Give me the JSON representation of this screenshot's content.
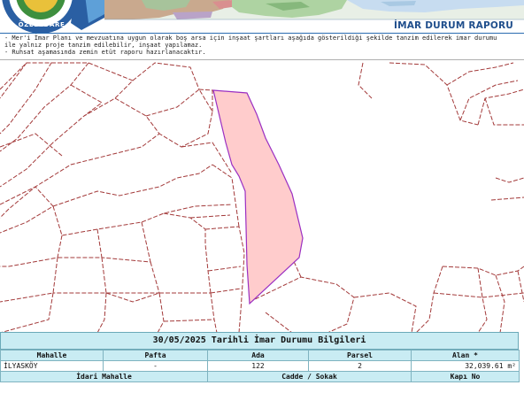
{
  "header": {
    "logo_text": "ÖZEL İDARE",
    "report_title": "İMAR DURUM RAPORU"
  },
  "notes": [
    "- Mer'i İmar Planı ve mevzuatına uygun olarak boş arsa için inşaat şartları aşağıda gösterildiği şekilde tanzim edilerek imar durumu",
    "ile yalnız proje tanzim edilebilir, inşaat yapılamaz.",
    "- Ruhsat aşamasında zemin etüt raporu hazırlanacaktır."
  ],
  "colors": {
    "parcel_highlight_fill": "#ffcccc",
    "parcel_highlight_stroke": "#9b2fc2",
    "parcel_lines": "#a33a3a",
    "table_header_bg": "#c9ecf3",
    "title_blue": "#1f4e8c"
  },
  "info": {
    "title": "30/05/2025 Tarihli İmar Durumu Bilgileri",
    "headers": {
      "mahalle": "Mahalle",
      "pafta": "Pafta",
      "ada": "Ada",
      "parsel": "Parsel",
      "alan": "Alan *"
    },
    "values": {
      "mahalle": "İLYASKÖY",
      "pafta": "-",
      "ada": "122",
      "parsel": "2",
      "alan": "32,039.61 m²"
    },
    "headers2": {
      "idari_mahalle": "İdari Mahalle",
      "cadde_sokak": "Cadde / Sokak",
      "kapi_no": "Kapı No"
    }
  }
}
